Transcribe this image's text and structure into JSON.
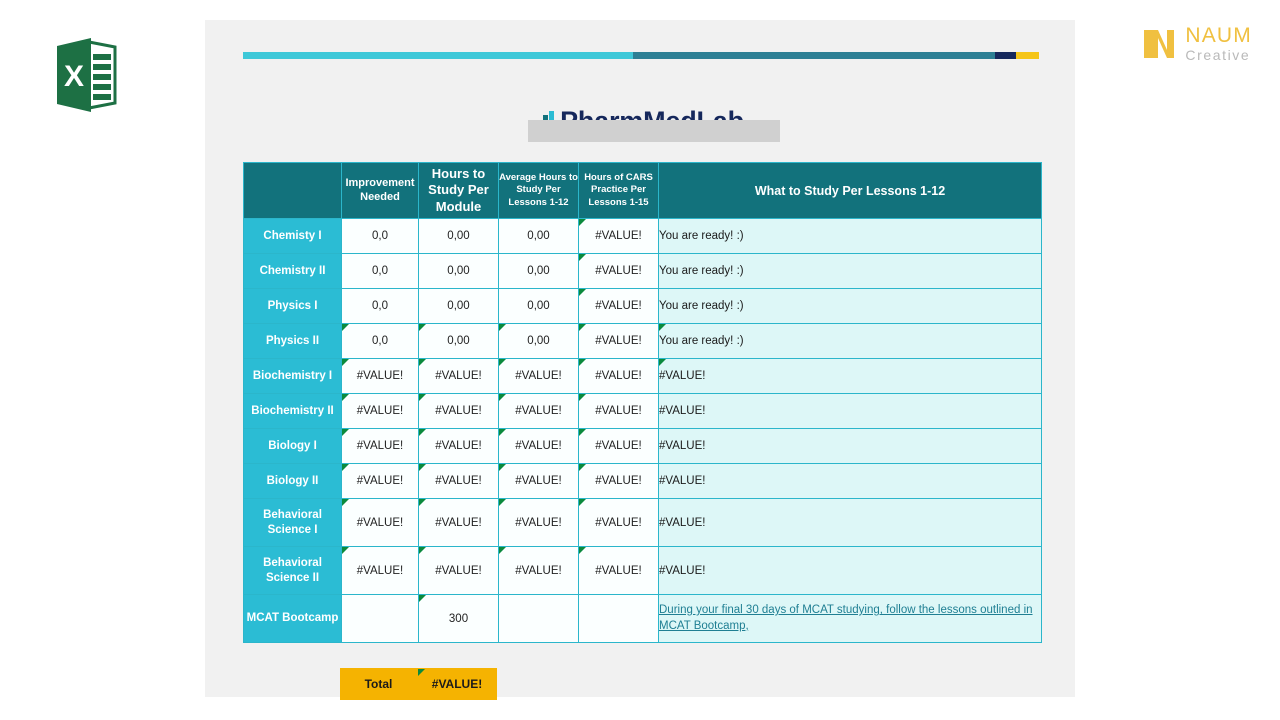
{
  "app": {
    "icon_name": "excel-file-icon",
    "icon_letter": "X"
  },
  "brand": {
    "name": "NAUM",
    "tagline": "Creative",
    "mark_name": "naum-monogram-icon",
    "name_color": "#f0c040",
    "tagline_color": "#b9b9b9"
  },
  "accent_bar": {
    "segments": [
      {
        "name": "cyan",
        "color": "#3ec8d8",
        "width_pct": 49
      },
      {
        "name": "teal",
        "color": "#2d7f94",
        "width_pct": 45.5
      },
      {
        "name": "navy",
        "color": "#16285c",
        "width_pct": 2.6
      },
      {
        "name": "amber",
        "color": "#f5c518",
        "width_pct": 2.9
      }
    ]
  },
  "slide": {
    "title": "PharmMedLab",
    "title_color": "#16285c",
    "title_icon_name": "chart-bars-icon",
    "redaction_present": true
  },
  "table": {
    "header_color": "#12727c",
    "rowlabel_color": "#2bbcd4",
    "headers": [
      "",
      "Improvement Needed",
      "Hours to Study Per Module",
      "Average Hours to Study Per Lessons 1-12",
      "Hours of CARS Practice Per Lessons 1-15",
      "What to Study Per Lessons 1-12"
    ],
    "headers_display": {
      "blank": "",
      "improvement": "Improvement\nNeeded",
      "hours_module": "Hours to\nStudy Per\nModule",
      "avg_hours": "Average Hours to\nStudy Per\nLessons 1-12",
      "cars": "Hours of CARS\nPractice Per\nLessons 1-15",
      "what_to_study": "What to Study Per Lessons 1-12"
    },
    "rows": [
      {
        "label": "Chemisty I",
        "improvement": "0,0",
        "hours_module": "0,00",
        "avg_hours": "0,00",
        "cars": "#VALUE!",
        "note": "You are ready! :)",
        "note_is_link": false,
        "tall": false
      },
      {
        "label": "Chemistry II",
        "improvement": "0,0",
        "hours_module": "0,00",
        "avg_hours": "0,00",
        "cars": "#VALUE!",
        "note": "You are ready! :)",
        "note_is_link": false,
        "tall": false
      },
      {
        "label": "Physics I",
        "improvement": "0,0",
        "hours_module": "0,00",
        "avg_hours": "0,00",
        "cars": "#VALUE!",
        "note": "You are ready! :)",
        "note_is_link": false,
        "tall": false
      },
      {
        "label": "Physics II",
        "improvement": "0,0",
        "hours_module": "0,00",
        "avg_hours": "0,00",
        "cars": "#VALUE!",
        "note": "You are ready! :)",
        "note_is_link": false,
        "tall": false
      },
      {
        "label": "Biochemistry I",
        "improvement": "#VALUE!",
        "hours_module": "#VALUE!",
        "avg_hours": "#VALUE!",
        "cars": "#VALUE!",
        "note": "#VALUE!",
        "note_is_link": false,
        "tall": false
      },
      {
        "label": "Biochemistry II",
        "improvement": "#VALUE!",
        "hours_module": "#VALUE!",
        "avg_hours": "#VALUE!",
        "cars": "#VALUE!",
        "note": "#VALUE!",
        "note_is_link": false,
        "tall": false
      },
      {
        "label": "Biology I",
        "improvement": "#VALUE!",
        "hours_module": "#VALUE!",
        "avg_hours": "#VALUE!",
        "cars": "#VALUE!",
        "note": "#VALUE!",
        "note_is_link": false,
        "tall": false
      },
      {
        "label": "Biology II",
        "improvement": "#VALUE!",
        "hours_module": "#VALUE!",
        "avg_hours": "#VALUE!",
        "cars": "#VALUE!",
        "note": "#VALUE!",
        "note_is_link": false,
        "tall": false
      },
      {
        "label": "Behavioral Science I",
        "improvement": "#VALUE!",
        "hours_module": "#VALUE!",
        "avg_hours": "#VALUE!",
        "cars": "#VALUE!",
        "note": "#VALUE!",
        "note_is_link": false,
        "tall": true
      },
      {
        "label": "Behavioral Science II",
        "improvement": "#VALUE!",
        "hours_module": "#VALUE!",
        "avg_hours": "#VALUE!",
        "cars": "#VALUE!",
        "note": "#VALUE!",
        "note_is_link": false,
        "tall": true
      },
      {
        "label": "MCAT Bootcamp",
        "improvement": "",
        "hours_module": "300",
        "avg_hours": "",
        "cars": "",
        "note": "During your final 30 days of MCAT studying, follow the lessons outlined in MCAT Bootcamp,",
        "note_is_link": true,
        "tall": true
      }
    ],
    "total": {
      "label": "Total",
      "value": "#VALUE!",
      "color": "#f5b301"
    }
  }
}
